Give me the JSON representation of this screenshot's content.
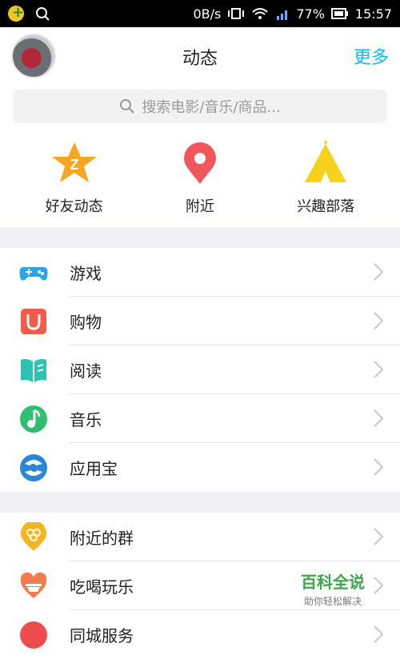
{
  "status_bar": {
    "speed": "0B/s",
    "battery": "77%",
    "time": "15:57"
  },
  "header": {
    "title": "动态",
    "more": "更多"
  },
  "search": {
    "placeholder": "搜索电影/音乐/商品..."
  },
  "quick_links": [
    {
      "label": "好友动态",
      "icon": "star-z-icon",
      "color": "#f5a623"
    },
    {
      "label": "附近",
      "icon": "location-pin-icon",
      "color": "#f0575b"
    },
    {
      "label": "兴趣部落",
      "icon": "tent-icon",
      "color": "#f7d21a"
    }
  ],
  "list1": [
    {
      "label": "游戏",
      "icon": "gamepad-icon",
      "color": "#2aa6e8"
    },
    {
      "label": "购物",
      "icon": "shopping-bag-icon",
      "color": "#ef5d48"
    },
    {
      "label": "阅读",
      "icon": "book-icon",
      "color": "#2ec2b0"
    },
    {
      "label": "音乐",
      "icon": "music-note-icon",
      "color": "#2fbf71"
    },
    {
      "label": "应用宝",
      "icon": "app-store-icon",
      "color": "#2b86d8"
    }
  ],
  "list2": [
    {
      "label": "附近的群",
      "icon": "nearby-group-icon",
      "color": "#f5b51d"
    },
    {
      "label": "吃喝玩乐",
      "icon": "food-fun-icon",
      "color": "#f47b4c"
    },
    {
      "label": "同城服务",
      "icon": "city-service-icon",
      "color": "#ef4d4d"
    }
  ],
  "watermark": {
    "title": "百科全说",
    "subtitle": "助你轻松解决"
  }
}
